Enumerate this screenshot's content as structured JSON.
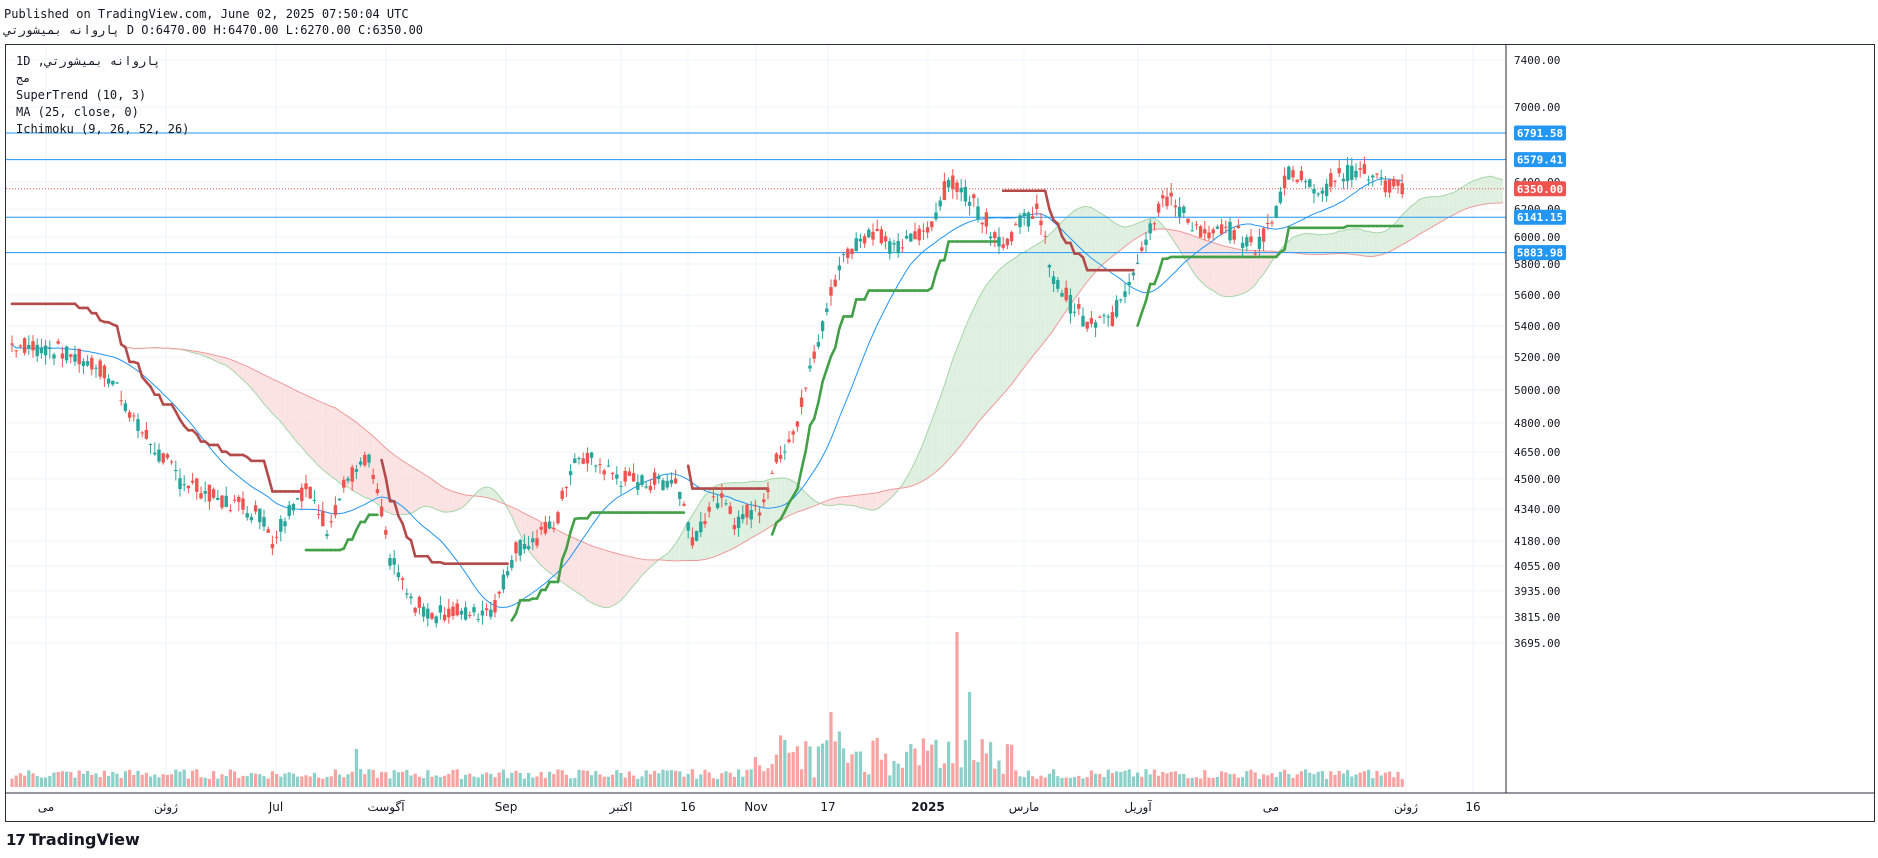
{
  "header": {
    "published": "Published on TradingView.com, June 02, 2025 07:50:04 UTC",
    "symbol_line": "پاروانه بمیشورتي D O:6470.00 H:6470.00 L:6270.00 C:6350.00"
  },
  "legend": {
    "symbol": "1D ,پاروانه بمیشورتي",
    "exchange": "مج",
    "supertrend": "SuperTrend (10, 3)",
    "ma": "MA (25, close, 0)",
    "ichimoku": "Ichimoku (9, 26, 52, 26)"
  },
  "footer": {
    "brand": "TradingView",
    "brand_mark": "17"
  },
  "colors": {
    "bull": "#26a69a",
    "bear": "#ef5350",
    "supertrend_up": "#43a047",
    "supertrend_down": "#b34b4b",
    "ma": "#2196f3",
    "hline": "#2196f3",
    "cloud_bull": "#d7ecd9",
    "cloud_bear": "#fbdcdc",
    "last_price": "#ef5350"
  },
  "chart_data": {
    "type": "candlestick",
    "y_ticks": [
      "7400.00",
      "7000.00",
      "6400.00",
      "6200.00",
      "6000.00",
      "5800.00",
      "5600.00",
      "5400.00",
      "5200.00",
      "5000.00",
      "4800.00",
      "4650.00",
      "4500.00",
      "4340.00",
      "4180.00",
      "4055.00",
      "3935.00",
      "3815.00",
      "3695.00"
    ],
    "x_ticks": [
      "می",
      "ژوئن",
      "Jul",
      "آگوست",
      "Sep",
      "اکتبر",
      "16",
      "Nov",
      "17",
      "2025",
      "مارس",
      "آوریل",
      "می",
      "ژوئن",
      "16"
    ],
    "price_labels": [
      {
        "text": "6791.58",
        "price": 6791.58,
        "kind": "hline"
      },
      {
        "text": "6579.41",
        "price": 6579.41,
        "kind": "hline"
      },
      {
        "text": "6350.00",
        "price": 6350.0,
        "kind": "last"
      },
      {
        "text": "6141.15",
        "price": 6141.15,
        "kind": "hline"
      },
      {
        "text": "5883.98",
        "price": 5883.98,
        "kind": "hline"
      }
    ],
    "last_price": 6350.0,
    "close_series_keypoints": [
      [
        0,
        5280
      ],
      [
        10,
        5250
      ],
      [
        20,
        5150
      ],
      [
        25,
        5020
      ],
      [
        30,
        4780
      ],
      [
        35,
        4640
      ],
      [
        40,
        4500
      ],
      [
        45,
        4440
      ],
      [
        50,
        4380
      ],
      [
        55,
        4360
      ],
      [
        60,
        4300
      ],
      [
        62,
        4180
      ],
      [
        66,
        4350
      ],
      [
        70,
        4450
      ],
      [
        75,
        4250
      ],
      [
        80,
        4500
      ],
      [
        85,
        4600
      ],
      [
        90,
        4100
      ],
      [
        95,
        3880
      ],
      [
        100,
        3830
      ],
      [
        105,
        3840
      ],
      [
        110,
        3830
      ],
      [
        115,
        3870
      ],
      [
        120,
        4150
      ],
      [
        125,
        4180
      ],
      [
        130,
        4300
      ],
      [
        133,
        4560
      ],
      [
        137,
        4620
      ],
      [
        145,
        4500
      ],
      [
        152,
        4480
      ],
      [
        158,
        4500
      ],
      [
        162,
        4200
      ],
      [
        168,
        4400
      ],
      [
        172,
        4280
      ],
      [
        178,
        4350
      ],
      [
        183,
        4650
      ],
      [
        187,
        4820
      ],
      [
        192,
        5300
      ],
      [
        197,
        5800
      ],
      [
        202,
        6000
      ],
      [
        206,
        6050
      ],
      [
        210,
        5900
      ],
      [
        214,
        5980
      ],
      [
        218,
        6050
      ],
      [
        223,
        6400
      ],
      [
        228,
        6300
      ],
      [
        232,
        6100
      ],
      [
        236,
        5950
      ],
      [
        240,
        6100
      ],
      [
        244,
        6200
      ],
      [
        248,
        5700
      ],
      [
        252,
        5550
      ],
      [
        256,
        5400
      ],
      [
        262,
        5450
      ],
      [
        266,
        5700
      ],
      [
        270,
        6000
      ],
      [
        274,
        6300
      ],
      [
        278,
        6200
      ],
      [
        284,
        6000
      ],
      [
        290,
        6050
      ],
      [
        296,
        5920
      ],
      [
        300,
        6100
      ],
      [
        304,
        6500
      ],
      [
        308,
        6400
      ],
      [
        312,
        6350
      ],
      [
        316,
        6450
      ],
      [
        320,
        6500
      ],
      [
        324,
        6450
      ],
      [
        328,
        6350
      ]
    ],
    "volume_note": "relative volume bars, taller in Nov-Jan"
  }
}
